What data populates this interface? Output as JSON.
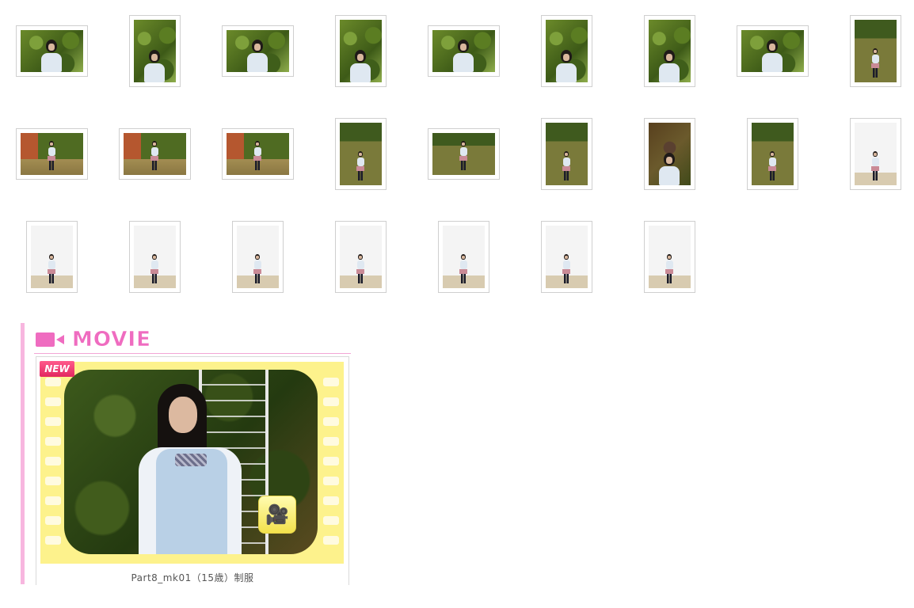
{
  "gallery": {
    "rows": [
      {
        "thumbs": [
          {
            "orientation": "land",
            "scene": "garden"
          },
          {
            "orientation": "port",
            "scene": "garden"
          },
          {
            "orientation": "land",
            "scene": "garden"
          },
          {
            "orientation": "port",
            "scene": "garden"
          },
          {
            "orientation": "land",
            "scene": "garden"
          },
          {
            "orientation": "port",
            "scene": "garden"
          },
          {
            "orientation": "port",
            "scene": "garden"
          },
          {
            "orientation": "land",
            "scene": "garden"
          },
          {
            "orientation": "port",
            "scene": "lawn"
          }
        ]
      },
      {
        "thumbs": [
          {
            "orientation": "land",
            "scene": "wall"
          },
          {
            "orientation": "land",
            "scene": "wall"
          },
          {
            "orientation": "land",
            "scene": "wall"
          },
          {
            "orientation": "port",
            "scene": "lawn"
          },
          {
            "orientation": "land",
            "scene": "lawn"
          },
          {
            "orientation": "port",
            "scene": "lawn"
          },
          {
            "orientation": "port",
            "scene": "portrait"
          },
          {
            "orientation": "port",
            "scene": "lawn"
          },
          {
            "orientation": "port",
            "scene": "studio"
          }
        ]
      },
      {
        "thumbs": [
          {
            "orientation": "port",
            "scene": "studio"
          },
          {
            "orientation": "port",
            "scene": "studio"
          },
          {
            "orientation": "port",
            "scene": "studio"
          },
          {
            "orientation": "port",
            "scene": "studio"
          },
          {
            "orientation": "port",
            "scene": "studio"
          },
          {
            "orientation": "port",
            "scene": "studio"
          },
          {
            "orientation": "port",
            "scene": "studio"
          }
        ]
      }
    ]
  },
  "movie": {
    "title": "MOVIE",
    "badge": "NEW",
    "caption": "Part8_mk01（15歳）制服",
    "icon": "video-camera-icon",
    "accent_color": "#ef6cc0",
    "film_color": "#fdf28c"
  }
}
